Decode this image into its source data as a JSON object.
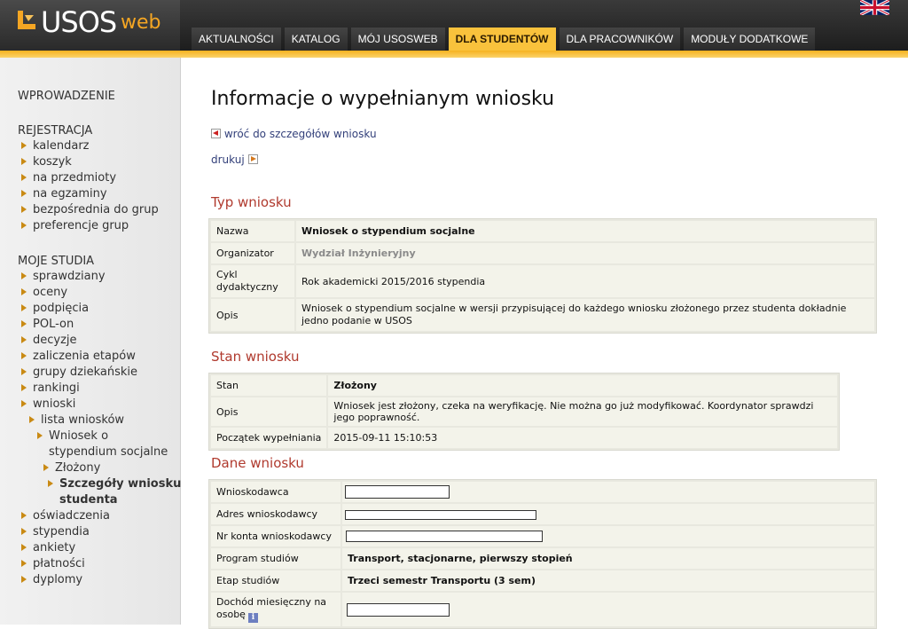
{
  "header": {
    "logo_usos": "USOS",
    "logo_web": "web",
    "nav": [
      {
        "label": "AKTUALNOŚCI"
      },
      {
        "label": "KATALOG"
      },
      {
        "label": "MÓJ USOSWEB"
      },
      {
        "label": "DLA STUDENTÓW",
        "active": true
      },
      {
        "label": "DLA PRACOWNIKÓW"
      },
      {
        "label": "MODUŁY DODATKOWE"
      }
    ],
    "language_icon": "uk-flag-icon",
    "accent_color": "#f9c23c"
  },
  "sidebar": {
    "sections": [
      {
        "title": "WPROWADZENIE",
        "items": []
      },
      {
        "title": "REJESTRACJA",
        "items": [
          "kalendarz",
          "koszyk",
          "na przedmioty",
          "na egzaminy",
          "bezpośrednia do grup",
          "preferencje grup"
        ]
      },
      {
        "title": "MOJE STUDIA",
        "items": [
          "sprawdziany",
          "oceny",
          "podpięcia",
          "POL-on",
          "decyzje",
          "zaliczenia etapów",
          "grupy dziekańskie",
          "rankingi",
          "wnioski"
        ]
      }
    ],
    "sub": {
      "lista": "lista wniosków",
      "wniosek_line1": "Wniosek o",
      "wniosek_line2": "stypendium socjalne",
      "zlozony": "Złożony",
      "szczegoly_line1": "Szczegóły wniosku",
      "szczegoly_line2": "studenta"
    },
    "after_items": [
      "oświadczenia",
      "stypendia",
      "ankiety",
      "płatności",
      "dyplomy"
    ]
  },
  "main": {
    "title": "Informacje o wypełnianym wniosku",
    "back_link": "wróć do szczegółów wniosku",
    "print_link": "drukuj",
    "typ": {
      "title": "Typ wniosku",
      "rows": [
        {
          "label": "Nazwa",
          "value": "Wniosek o stypendium socjalne"
        },
        {
          "label": "Organizator",
          "value": "Wydział Inżynieryjny"
        },
        {
          "label_line1": "Cykl",
          "label_line2": "dydaktyczny",
          "value": "Rok akademicki 2015/2016 stypendia"
        },
        {
          "label": "Opis",
          "value": "Wniosek o stypendium socjalne w wersji przypisującej do każdego wniosku złożonego przez studenta dokładnie jedno podanie w USOS"
        }
      ]
    },
    "stan": {
      "title": "Stan wniosku",
      "rows": [
        {
          "label": "Stan",
          "value": "Złożony"
        },
        {
          "label": "Opis",
          "value": "Wniosek jest złożony, czeka na weryfikację. Nie można go już modyfikować. Koordynator sprawdzi jego poprawność."
        },
        {
          "label": "Początek wypełniania",
          "value": "2015-09-11 15:10:53"
        }
      ]
    },
    "dane": {
      "title": "Dane wniosku",
      "rows": [
        {
          "label": "Wnioskodawca",
          "value": ""
        },
        {
          "label": "Adres wnioskodawcy",
          "value": ""
        },
        {
          "label": "Nr konta wnioskodawcy",
          "value": ""
        },
        {
          "label": "Program studiów",
          "value": "Transport, stacjonarne, pierwszy stopień"
        },
        {
          "label": "Etap studiów",
          "value": "Trzeci semestr Transportu (3 sem)"
        },
        {
          "label_line1": "Dochód miesięczny na",
          "label_line2": "osobę",
          "value": ""
        }
      ]
    }
  }
}
